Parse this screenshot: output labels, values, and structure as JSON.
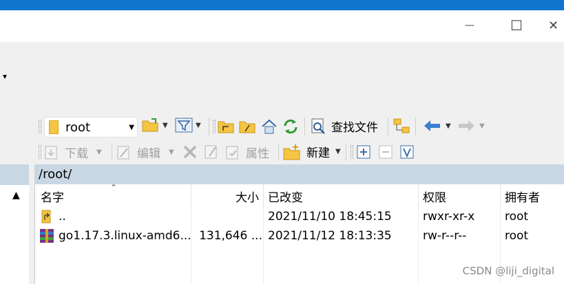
{
  "window": {
    "minimize_glyph": "—",
    "maximize_glyph": "☐",
    "close_glyph": "✕"
  },
  "ribbon": {
    "dropdown_glyph": "▾"
  },
  "toolbar1": {
    "location": "root",
    "find_files_label": "查找文件"
  },
  "toolbar2": {
    "download_label": "下载",
    "edit_label": "编辑",
    "properties_label": "属性",
    "new_label": "新建"
  },
  "path": "/root/",
  "columns": {
    "name": "名字",
    "size": "大小",
    "changed": "已改变",
    "rights": "权限",
    "owner": "拥有者"
  },
  "files": [
    {
      "name": "..",
      "size": "",
      "changed": "2021/11/10 18:45:15",
      "rights": "rwxr-xr-x",
      "owner": "root",
      "icon": "parent-folder-icon"
    },
    {
      "name": "go1.17.3.linux-amd6...",
      "size": "131,646 ...",
      "changed": "2021/11/12 18:13:35",
      "rights": "rw-r--r--",
      "owner": "root",
      "icon": "archive-icon"
    }
  ],
  "watermark": "CSDN @liji_digital",
  "colors": {
    "title_accent": "#0f75cf",
    "path_bar": "#c8d7e3",
    "toolbar_bg": "#f0f0f0"
  }
}
